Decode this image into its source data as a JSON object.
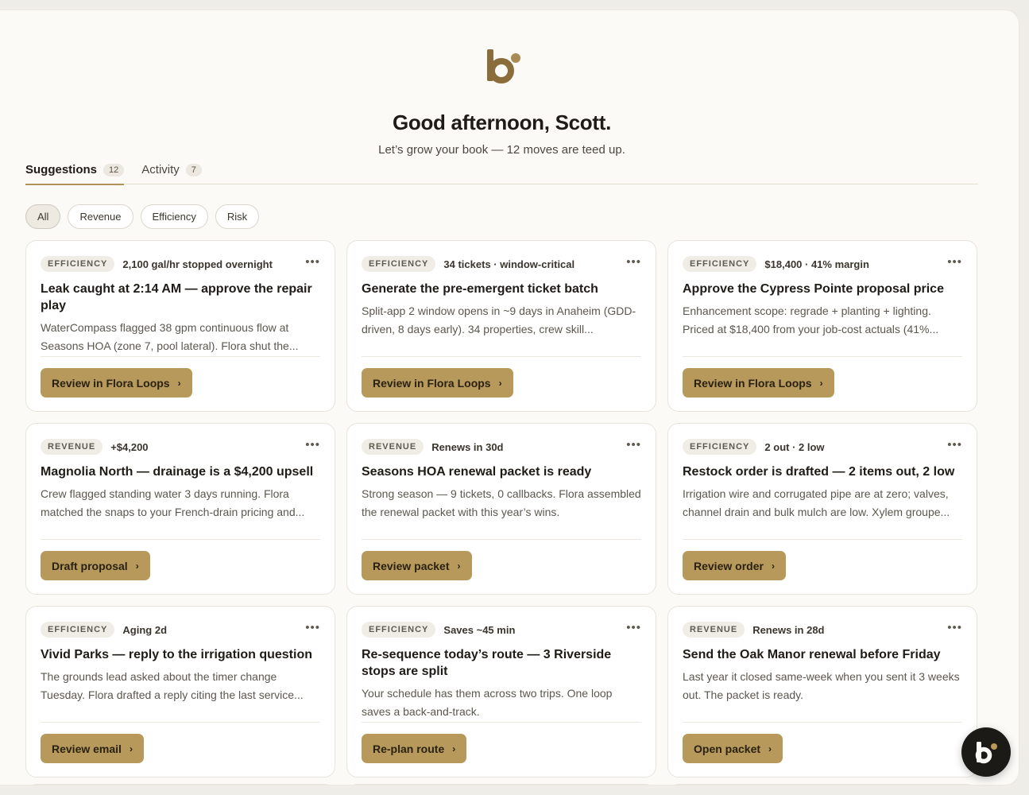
{
  "header": {
    "greeting": "Good afternoon, Scott.",
    "subtitle": "Let’s grow your book — 12 moves are teed up."
  },
  "tabs": [
    {
      "label": "Suggestions",
      "count": "12",
      "active": true
    },
    {
      "label": "Activity",
      "count": "7",
      "active": false
    }
  ],
  "filters": [
    {
      "label": "All",
      "active": true
    },
    {
      "label": "Revenue",
      "active": false
    },
    {
      "label": "Efficiency",
      "active": false
    },
    {
      "label": "Risk",
      "active": false
    }
  ],
  "cards": [
    {
      "badge": "EFFICIENCY",
      "meta": "2,100 gal/hr stopped overnight",
      "title": "Leak caught at 2:14 AM — approve the repair play",
      "desc": "WaterCompass flagged 38 gpm continuous flow at Seasons HOA (zone 7, pool lateral). Flora shut the...",
      "action": "Review in Flora Loops"
    },
    {
      "badge": "EFFICIENCY",
      "meta": "34 tickets · window-critical",
      "title": "Generate the pre-emergent ticket batch",
      "desc": "Split-app 2 window opens in ~9 days in Anaheim (GDD-driven, 8 days early). 34 properties, crew skill...",
      "action": "Review in Flora Loops"
    },
    {
      "badge": "EFFICIENCY",
      "meta": "$18,400 · 41% margin",
      "title": "Approve the Cypress Pointe proposal price",
      "desc": "Enhancement scope: regrade + planting + lighting. Priced at $18,400 from your job-cost actuals (41%...",
      "action": "Review in Flora Loops"
    },
    {
      "badge": "REVENUE",
      "meta": "+$4,200",
      "title": "Magnolia North — drainage is a $4,200 upsell",
      "desc": "Crew flagged standing water 3 days running. Flora matched the snaps to your French-drain pricing and...",
      "action": "Draft proposal"
    },
    {
      "badge": "REVENUE",
      "meta": "Renews in 30d",
      "title": "Seasons HOA renewal packet is ready",
      "desc": "Strong season — 9 tickets, 0 callbacks. Flora assembled the renewal packet with this year’s wins.",
      "action": "Review packet"
    },
    {
      "badge": "EFFICIENCY",
      "meta": "2 out · 2 low",
      "title": "Restock order is drafted — 2 items out, 2 low",
      "desc": "Irrigation wire and corrugated pipe are at zero; valves, channel drain and bulk mulch are low. Xylem groupe...",
      "action": "Review order"
    },
    {
      "badge": "EFFICIENCY",
      "meta": "Aging 2d",
      "title": "Vivid Parks — reply to the irrigation question",
      "desc": "The grounds lead asked about the timer change Tuesday. Flora drafted a reply citing the last service...",
      "action": "Review email"
    },
    {
      "badge": "EFFICIENCY",
      "meta": "Saves ~45 min",
      "title": "Re-sequence today’s route — 3 Riverside stops are split",
      "desc": "Your schedule has them across two trips. One loop saves a back-and-track.",
      "action": "Re-plan route"
    },
    {
      "badge": "REVENUE",
      "meta": "Renews in 28d",
      "title": "Send the Oak Manor renewal before Friday",
      "desc": "Last year it closed same-week when you sent it 3 weeks out. The packet is ready.",
      "action": "Open packet"
    }
  ],
  "icons": {
    "logo": "brand-b-icon",
    "more": "more-dots-icon",
    "chevron": "chevron-right-icon",
    "assistant": "assistant-bubble-icon"
  },
  "colors": {
    "brand": "#8a6d3b",
    "accent_button": "#b6995b",
    "fab": "#1c1a17"
  }
}
